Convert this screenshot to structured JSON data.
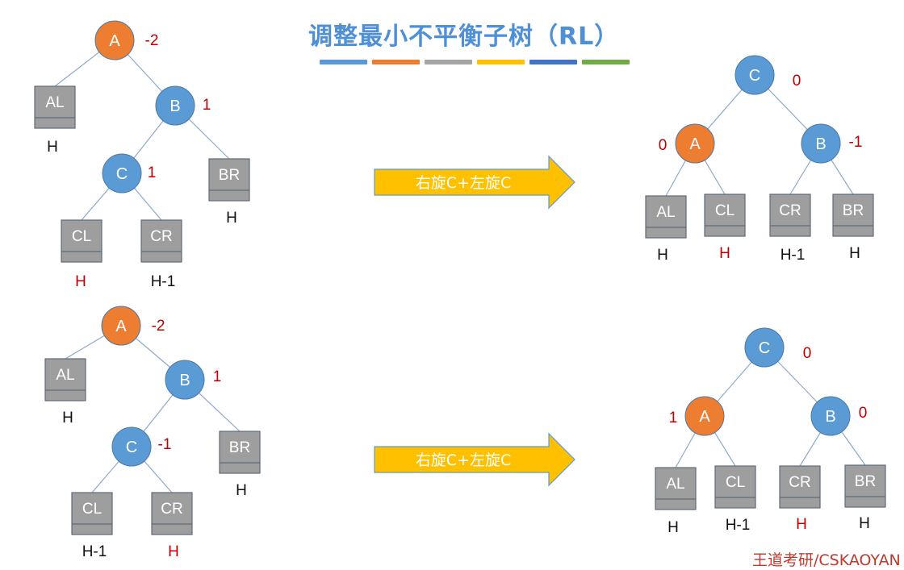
{
  "title": "调整最小不平衡子树（RL）",
  "footer": "王道考研/CSKAOYAN",
  "colors": {
    "node_blue": "#5b9bd5",
    "node_orange": "#ed7d31",
    "subtree_gray": "#9e9e9e",
    "balance_red": "#c00000",
    "height_red": "#c00000",
    "arrow_fill": "#ffc000",
    "edge": "#8ea9c8"
  },
  "color_bar": [
    "#5b9bd5",
    "#ed7d31",
    "#a5a5a5",
    "#ffc000",
    "#4472c4",
    "#70ad47"
  ],
  "diagrams": [
    {
      "name": "case-1-before",
      "nodes": [
        {
          "id": "A",
          "label": "A",
          "balance": "-2"
        },
        {
          "id": "B",
          "label": "B",
          "balance": "1"
        },
        {
          "id": "C",
          "label": "C",
          "balance": "1"
        }
      ],
      "subtrees": [
        {
          "label": "AL",
          "height": "H"
        },
        {
          "label": "BR",
          "height": "H"
        },
        {
          "label": "CL",
          "height": "H",
          "height_highlight": true
        },
        {
          "label": "CR",
          "height": "H-1"
        }
      ]
    },
    {
      "name": "case-1-after",
      "nodes": [
        {
          "id": "C",
          "label": "C",
          "balance": "0"
        },
        {
          "id": "A",
          "label": "A",
          "balance": "0"
        },
        {
          "id": "B",
          "label": "B",
          "balance": "-1"
        }
      ],
      "subtrees": [
        {
          "label": "AL",
          "height": "H"
        },
        {
          "label": "CL",
          "height": "H",
          "height_highlight": true
        },
        {
          "label": "CR",
          "height": "H-1"
        },
        {
          "label": "BR",
          "height": "H"
        }
      ]
    },
    {
      "name": "case-2-before",
      "nodes": [
        {
          "id": "A",
          "label": "A",
          "balance": "-2"
        },
        {
          "id": "B",
          "label": "B",
          "balance": "1"
        },
        {
          "id": "C",
          "label": "C",
          "balance": "-1"
        }
      ],
      "subtrees": [
        {
          "label": "AL",
          "height": "H"
        },
        {
          "label": "BR",
          "height": "H"
        },
        {
          "label": "CL",
          "height": "H-1"
        },
        {
          "label": "CR",
          "height": "H",
          "height_highlight": true
        }
      ]
    },
    {
      "name": "case-2-after",
      "nodes": [
        {
          "id": "C",
          "label": "C",
          "balance": "0"
        },
        {
          "id": "A",
          "label": "A",
          "balance": "1"
        },
        {
          "id": "B",
          "label": "B",
          "balance": "0"
        }
      ],
      "subtrees": [
        {
          "label": "AL",
          "height": "H"
        },
        {
          "label": "CL",
          "height": "H-1"
        },
        {
          "label": "CR",
          "height": "H",
          "height_highlight": true
        },
        {
          "label": "BR",
          "height": "H"
        }
      ]
    }
  ],
  "arrows": [
    {
      "label": "右旋C+左旋C"
    },
    {
      "label": "右旋C+左旋C"
    }
  ]
}
